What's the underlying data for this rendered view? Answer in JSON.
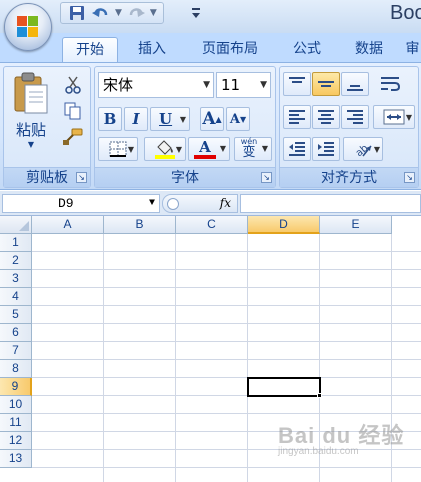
{
  "window": {
    "title": "Boo"
  },
  "quick_access": {
    "icons": [
      "save-icon",
      "undo-icon",
      "redo-icon",
      "customize-icon"
    ]
  },
  "tabs": [
    {
      "label": "开始",
      "active": true
    },
    {
      "label": "插入",
      "active": false
    },
    {
      "label": "页面布局",
      "active": false
    },
    {
      "label": "公式",
      "active": false
    },
    {
      "label": "数据",
      "active": false
    },
    {
      "label": "审",
      "active": false
    }
  ],
  "clipboard": {
    "paste_label": "粘贴",
    "group_label": "剪贴板"
  },
  "font": {
    "font_name": "宋体",
    "font_size": "11",
    "bold_label": "B",
    "italic_label": "I",
    "underline_label": "U",
    "grow_label": "A",
    "shrink_label": "A",
    "font_color_label": "A",
    "phonetic_label": "wén",
    "phonetic_char": "变",
    "group_label": "字体",
    "fill_color": "#ffff00",
    "font_color": "#e00000"
  },
  "alignment": {
    "group_label": "对齐方式"
  },
  "formula_bar": {
    "name_box": "D9",
    "fx_label": "fx",
    "formula": ""
  },
  "sheet": {
    "columns": [
      "A",
      "B",
      "C",
      "D",
      "E"
    ],
    "rows": [
      "1",
      "2",
      "3",
      "4",
      "5",
      "6",
      "7",
      "8",
      "9",
      "10",
      "11",
      "12",
      "13"
    ],
    "selected_column": "D",
    "selected_row": "9",
    "active_cell": "D9"
  },
  "watermark": {
    "main": "Bai du 经验",
    "sub": "jingyan.baidu.com"
  }
}
